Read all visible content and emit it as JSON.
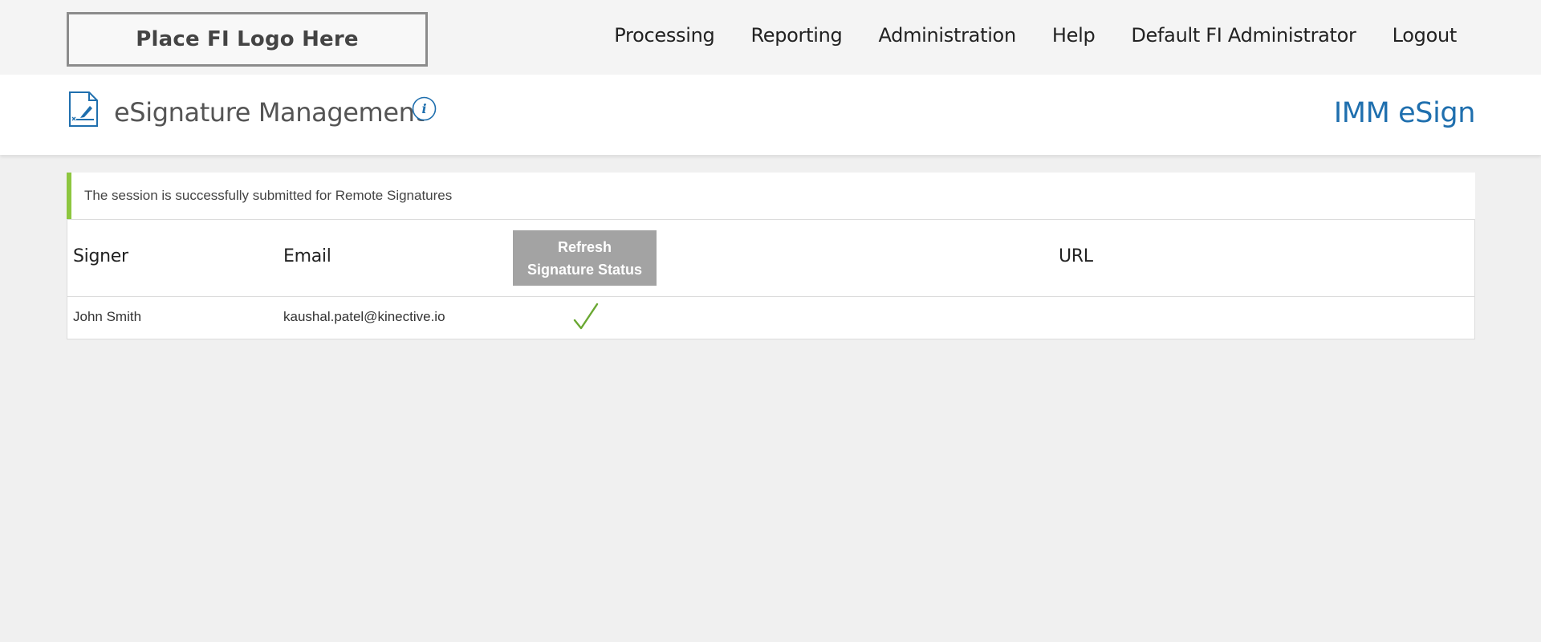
{
  "header": {
    "logo_text": "Place FI Logo Here",
    "nav": [
      {
        "label": "Processing"
      },
      {
        "label": "Reporting"
      },
      {
        "label": "Administration"
      },
      {
        "label": "Help"
      },
      {
        "label": "Default FI Administrator"
      },
      {
        "label": "Logout"
      }
    ]
  },
  "title_band": {
    "page_title": "eSignature Management",
    "brand": "IMM eSign",
    "icons": [
      "document-signature-icon",
      "info-icon"
    ]
  },
  "alert": {
    "message": "The session is successfully submitted for Remote Signatures",
    "status": "success",
    "accent_color": "#8dc63f"
  },
  "table": {
    "columns": {
      "signer": "Signer",
      "email": "Email",
      "refresh_line1": "Refresh",
      "refresh_line2": "Signature Status",
      "url": "URL"
    },
    "rows": [
      {
        "signer": "John Smith",
        "email": "kaushal.patel@kinective.io",
        "status_icon": "check-icon",
        "url": ""
      }
    ]
  },
  "colors": {
    "brand": "#1f6fae",
    "success": "#8dc63f",
    "button_gray": "#a3a3a3",
    "background": "#f0f0f0"
  }
}
